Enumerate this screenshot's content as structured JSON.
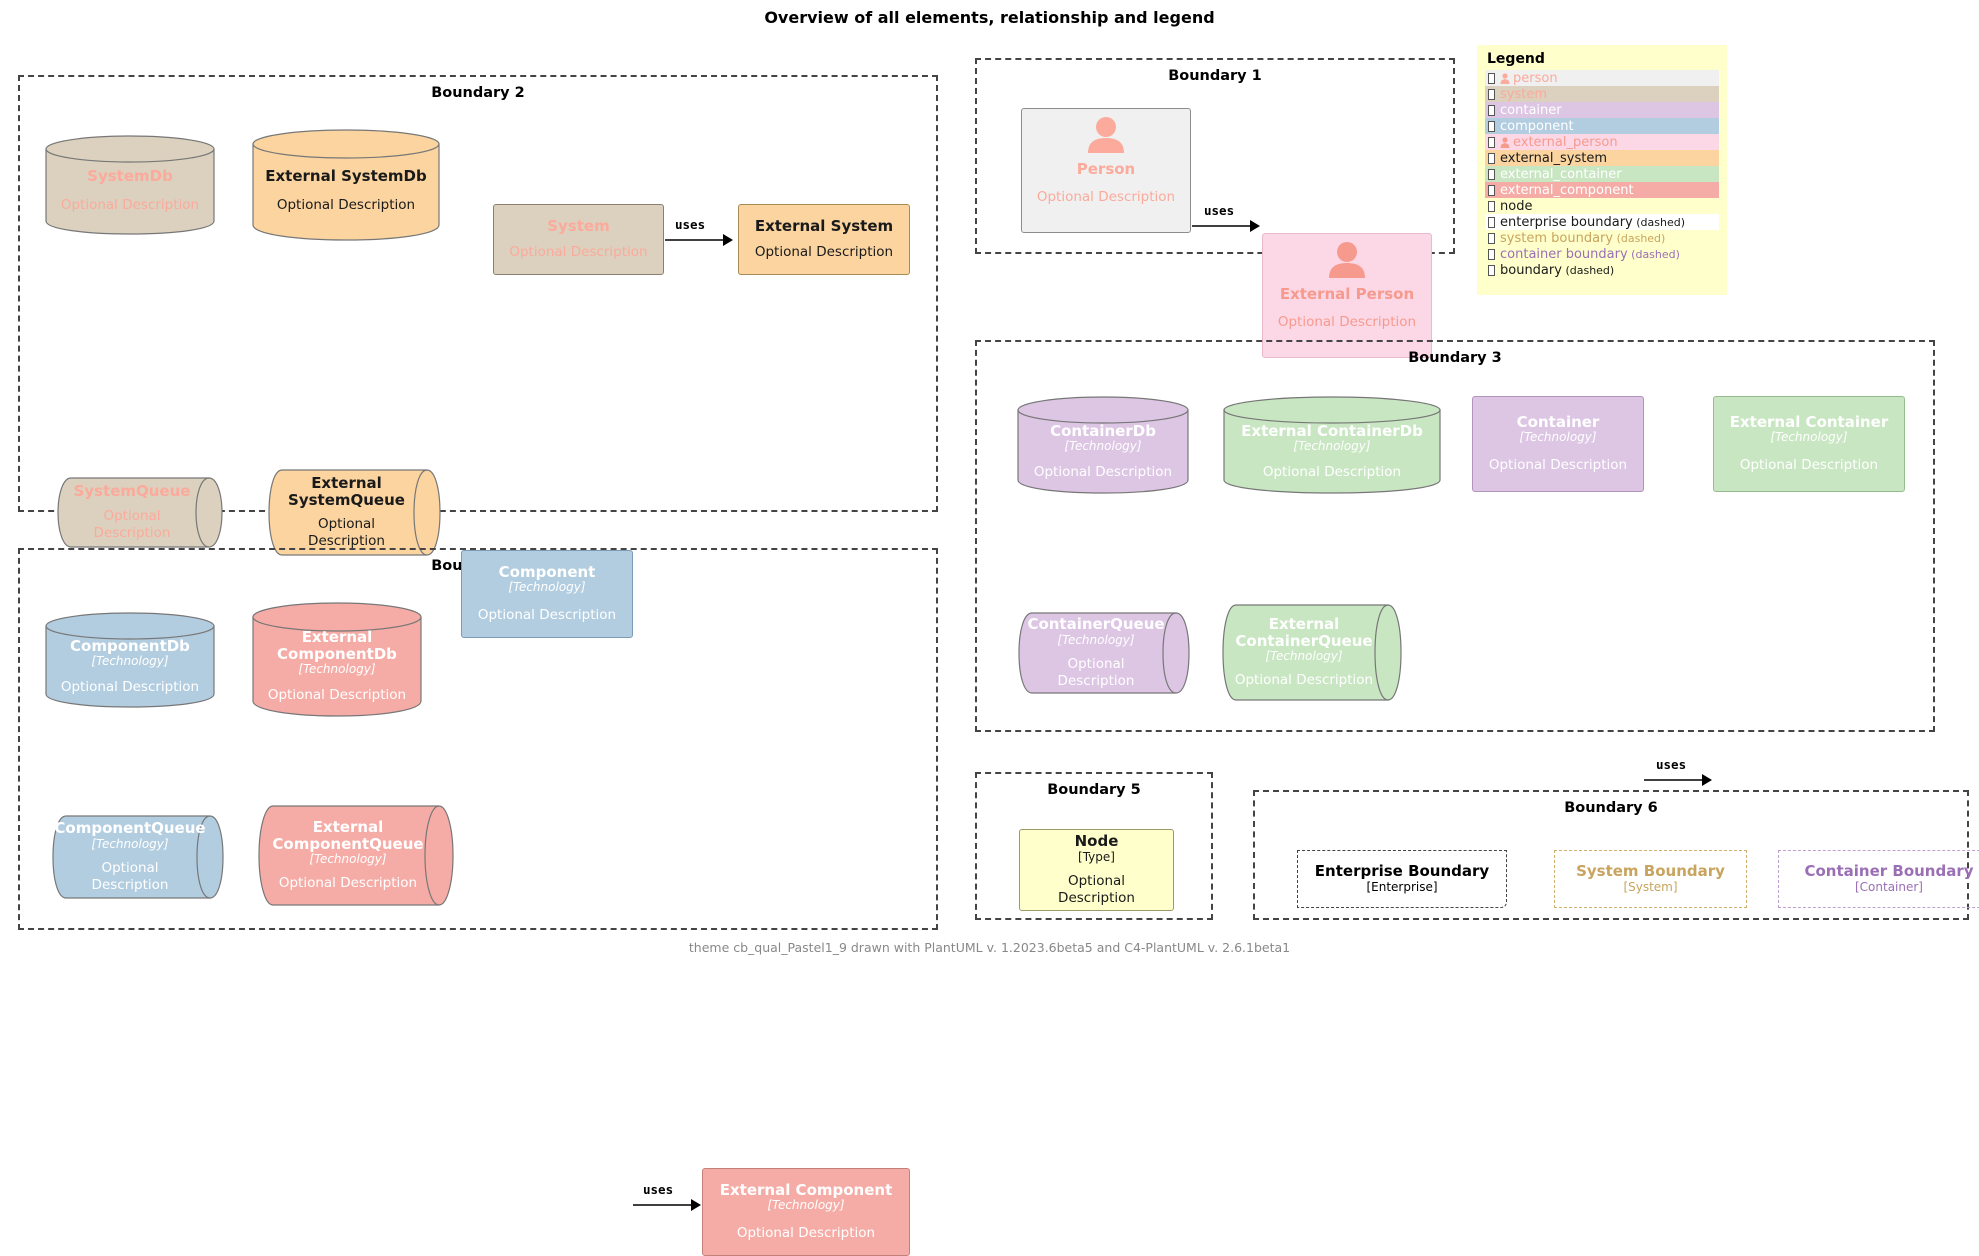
{
  "title": "Overview of all elements, relationship and legend",
  "footer": "theme cb_qual_Pastel1_9 drawn with PlantUML v. 1.2023.6beta5 and C4-PlantUML v. 2.6.1beta1",
  "relationship_label": "uses",
  "colors": {
    "person": "#f0f0f0",
    "person_text": "#fbaa9c",
    "external_person": "#fcd8e6",
    "external_person_text": "#f79a8e",
    "system": "#dbd1be",
    "system_text": "#fbaa9c",
    "external_system": "#fbd4a0",
    "external_system_text": "#1a1a1a",
    "container": "#ddc5e4",
    "container_text": "#ffffff",
    "external_container": "#c9e6c2",
    "external_container_text": "#ffffff",
    "component": "#b2cde0",
    "component_text": "#ffffff",
    "external_component": "#f6aca6",
    "external_component_text": "#ffffff",
    "node": "#ffffcc",
    "node_text": "#1a1a1a",
    "boundary": "#444444",
    "system_boundary": "#c8a45e",
    "container_boundary": "#9a6fb5",
    "legend_bg": "#ffffcc"
  },
  "boundaries": {
    "b1": {
      "label": "Boundary 1"
    },
    "b2": {
      "label": "Boundary 2"
    },
    "b3": {
      "label": "Boundary 3"
    },
    "b4": {
      "label": "Boundary 4"
    },
    "b5": {
      "label": "Boundary 5"
    },
    "b6": {
      "label": "Boundary 6"
    }
  },
  "elements": {
    "person": {
      "name": "Person",
      "tech": "",
      "desc": "Optional Description"
    },
    "external_person": {
      "name": "External Person",
      "tech": "",
      "desc": "Optional Description"
    },
    "system_db": {
      "name": "SystemDb",
      "tech": "",
      "desc": "Optional Description"
    },
    "external_system_db": {
      "name": "External SystemDb",
      "tech": "",
      "desc": "Optional Description"
    },
    "system": {
      "name": "System",
      "tech": "",
      "desc": "Optional Description"
    },
    "external_system": {
      "name": "External System",
      "tech": "",
      "desc": "Optional Description"
    },
    "system_queue": {
      "name": "SystemQueue",
      "tech": "",
      "desc": "Optional Description"
    },
    "external_system_queue": {
      "name": "External SystemQueue",
      "tech": "",
      "desc": "Optional Description"
    },
    "container_db": {
      "name": "ContainerDb",
      "tech": "[Technology]",
      "desc": "Optional Description"
    },
    "external_container_db": {
      "name": "External ContainerDb",
      "tech": "[Technology]",
      "desc": "Optional Description"
    },
    "container": {
      "name": "Container",
      "tech": "[Technology]",
      "desc": "Optional Description"
    },
    "external_container": {
      "name": "External Container",
      "tech": "[Technology]",
      "desc": "Optional Description"
    },
    "container_queue": {
      "name": "ContainerQueue",
      "tech": "[Technology]",
      "desc": "Optional Description"
    },
    "external_container_queue": {
      "name": "External ContainerQueue",
      "tech": "[Technology]",
      "desc": "Optional Description"
    },
    "component_db": {
      "name": "ComponentDb",
      "tech": "[Technology]",
      "desc": "Optional Description"
    },
    "external_component_db": {
      "name": "External ComponentDb",
      "tech": "[Technology]",
      "desc": "Optional Description"
    },
    "component": {
      "name": "Component",
      "tech": "[Technology]",
      "desc": "Optional Description"
    },
    "external_component": {
      "name": "External Component",
      "tech": "[Technology]",
      "desc": "Optional Description"
    },
    "component_queue": {
      "name": "ComponentQueue",
      "tech": "[Technology]",
      "desc": "Optional Description"
    },
    "external_component_queue": {
      "name": "External ComponentQueue",
      "tech": "[Technology]",
      "desc": "Optional Description"
    },
    "node": {
      "name": "Node",
      "tech": "[Type]",
      "desc": "Optional Description"
    }
  },
  "nested_boundaries": [
    {
      "name": "Enterprise Boundary",
      "type": "[Enterprise]"
    },
    {
      "name": "System Boundary",
      "type": "[System]"
    },
    {
      "name": "Container Boundary",
      "type": "[Container]"
    }
  ],
  "legend": {
    "title": "Legend",
    "items": [
      {
        "label": "person",
        "suffix": "",
        "bg": "#f0f0f0",
        "text": "#fbaa9c",
        "person_icon": true
      },
      {
        "label": "system",
        "suffix": "",
        "bg": "#dbd1be",
        "text": "#fbaa9c",
        "person_icon": false
      },
      {
        "label": "container",
        "suffix": "",
        "bg": "#ddc5e4",
        "text": "#ffffff",
        "person_icon": false
      },
      {
        "label": "component",
        "suffix": "",
        "bg": "#b2cde0",
        "text": "#ffffff",
        "person_icon": false
      },
      {
        "label": "external_person",
        "suffix": "",
        "bg": "#fcd8e6",
        "text": "#f79a8e",
        "person_icon": true
      },
      {
        "label": "external_system",
        "suffix": "",
        "bg": "#fbd4a0",
        "text": "#1a1a1a",
        "person_icon": false
      },
      {
        "label": "external_container",
        "suffix": "",
        "bg": "#c9e6c2",
        "text": "#ffffff",
        "person_icon": false
      },
      {
        "label": "external_component",
        "suffix": "",
        "bg": "#f6aca6",
        "text": "#ffffff",
        "person_icon": false
      },
      {
        "label": "node",
        "suffix": "",
        "bg": "#ffffcc",
        "text": "#1a1a1a",
        "person_icon": false
      },
      {
        "label": "enterprise boundary",
        "suffix": "(dashed)",
        "bg": "#ffffff",
        "text": "#1a1a1a",
        "person_icon": false
      },
      {
        "label": "system boundary",
        "suffix": "(dashed)",
        "bg": "#ffffcc",
        "text": "#c8a45e",
        "person_icon": false
      },
      {
        "label": "container boundary",
        "suffix": "(dashed)",
        "bg": "#ffffcc",
        "text": "#9a6fb5",
        "person_icon": false
      },
      {
        "label": "boundary",
        "suffix": "(dashed)",
        "bg": "#ffffcc",
        "text": "#1a1a1a",
        "person_icon": false
      }
    ]
  }
}
